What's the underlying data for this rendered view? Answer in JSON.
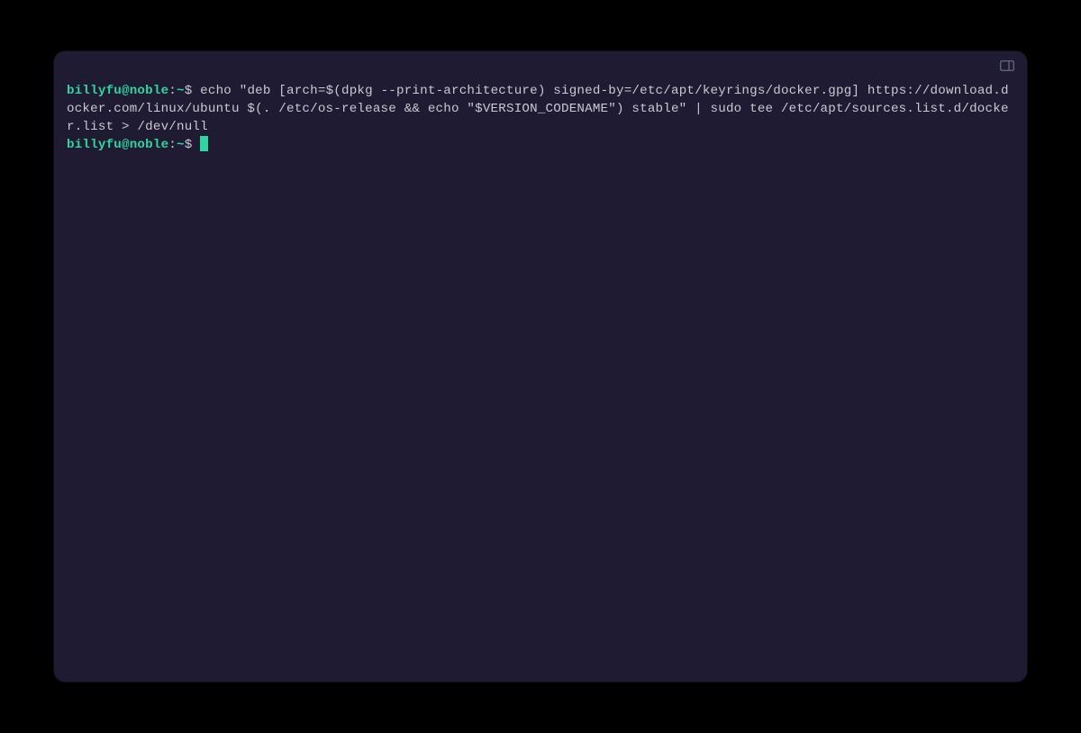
{
  "terminal": {
    "prompt": {
      "user_host": "billyfu@noble",
      "separator": ":",
      "path": "~",
      "symbol": "$"
    },
    "lines": [
      {
        "type": "command",
        "text": "echo \"deb [arch=$(dpkg --print-architecture) signed-by=/etc/apt/keyrings/docker.gpg] https://download.docker.com/linux/ubuntu $(. /etc/os-release && echo \"$VERSION_CODENAME\") stable\" | sudo tee /etc/apt/sources.list.d/docker.list > /dev/null"
      }
    ]
  },
  "colors": {
    "background": "#1e1b33",
    "prompt_green": "#2fd6a0",
    "text": "#c9c9d1"
  }
}
